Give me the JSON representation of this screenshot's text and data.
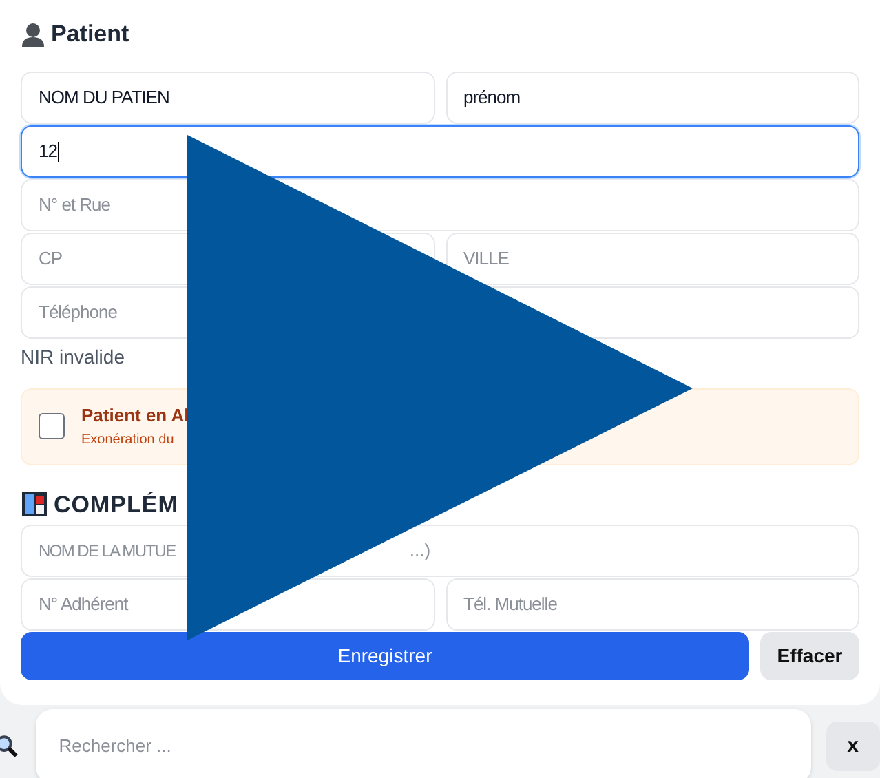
{
  "patient": {
    "title": "Patient",
    "fields": [
      {
        "kind": "value",
        "text": "NOM DU PATIEN"
      },
      {
        "kind": "value",
        "text": "prénom"
      }
    ],
    "nir": {
      "text": "12",
      "focused": true
    },
    "address": {
      "placeholder": "N° et Rue"
    },
    "city": [
      {
        "placeholder": "CP"
      },
      {
        "placeholder": "VILLE"
      }
    ],
    "phone": {
      "placeholder": "Téléphone"
    },
    "error": "NIR invalide",
    "ald": {
      "checked": false,
      "title": "Patient en Al",
      "subtitle": "Exonération du"
    }
  },
  "complementary": {
    "title": "COMPLÉM",
    "mutuelle": {
      "placeholder": "NOM DE LA MUTUE",
      "tail": "...)"
    },
    "fields": [
      {
        "placeholder": "N° Adhérent"
      },
      {
        "placeholder": "Tél. Mutuelle"
      }
    ]
  },
  "buttons": [
    {
      "kind": "primary",
      "label": "Enregistrer"
    },
    {
      "kind": "secondary",
      "label": "Effacer"
    }
  ],
  "search": {
    "placeholder": "Rechercher ...",
    "clear": "x"
  }
}
